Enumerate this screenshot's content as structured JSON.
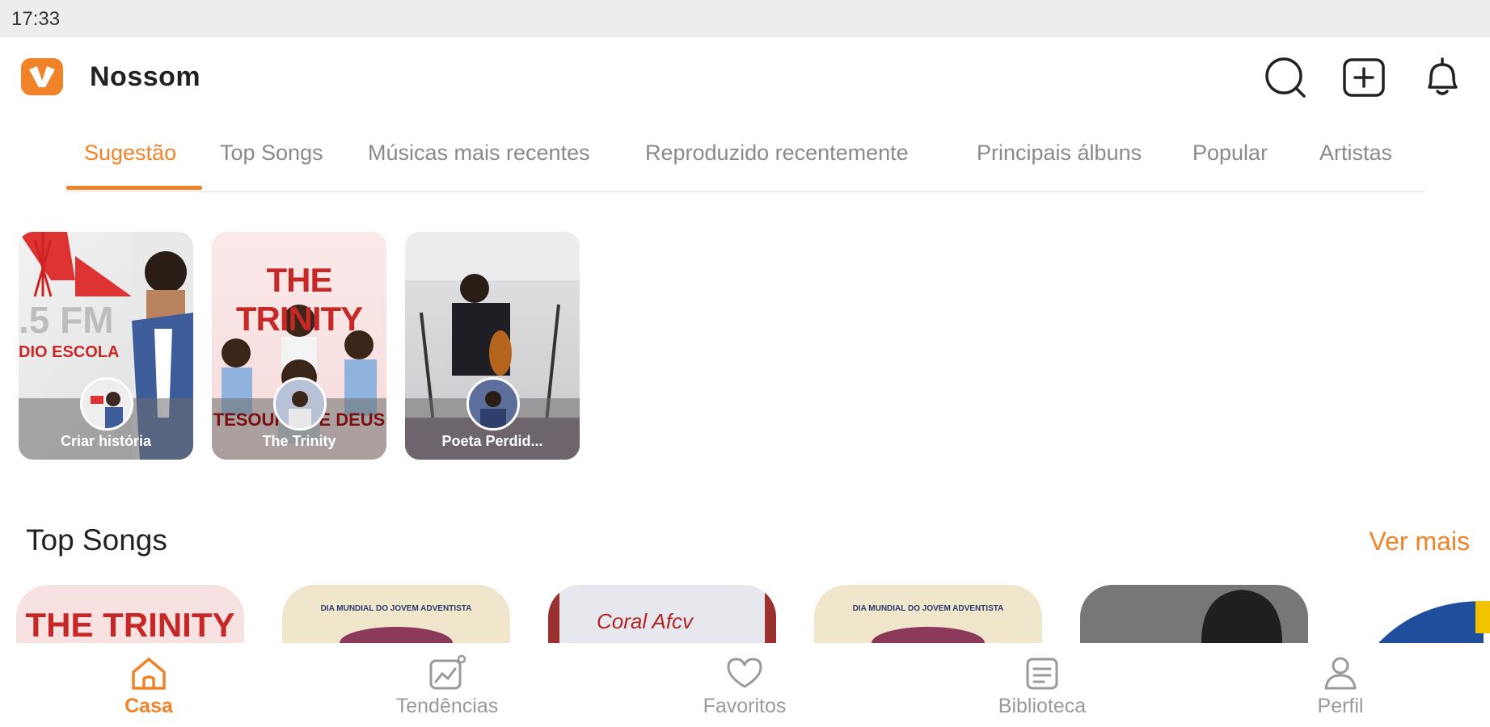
{
  "status": {
    "time": "17:33"
  },
  "app": {
    "name": "Nossom",
    "accent": "#f0832a"
  },
  "header_icons": [
    "search-icon",
    "add-post-icon",
    "bell-icon"
  ],
  "tabs": [
    {
      "label": "Sugestão",
      "active": true
    },
    {
      "label": "Top Songs"
    },
    {
      "label": "Músicas mais recentes"
    },
    {
      "label": "Reproduzido recentemente"
    },
    {
      "label": "Principais álbuns"
    },
    {
      "label": "Popular"
    },
    {
      "label": "Artistas"
    }
  ],
  "stories": [
    {
      "label": "Criar história",
      "poster_text": ".5 FM",
      "poster_sub": "DIO ESCOLA"
    },
    {
      "label": "The Trinity",
      "poster_text": "THE TRINITY",
      "poster_sub": "TESOURO DE DEUS"
    },
    {
      "label": "Poeta Perdid..."
    }
  ],
  "top_songs": {
    "title": "Top Songs",
    "see_more": "Ver mais",
    "covers": [
      {
        "text": "THE TRINITY"
      },
      {
        "text": "DIA MUNDIAL DO JOVEM ADVENTISTA"
      },
      {
        "text": "Coral Afcv"
      },
      {
        "text": "DIA MUNDIAL DO JOVEM ADVENTISTA"
      },
      {
        "text": ""
      },
      {
        "text": ""
      }
    ]
  },
  "bottom_nav": [
    {
      "label": "Casa",
      "icon": "home-icon",
      "active": true
    },
    {
      "label": "Tendências",
      "icon": "trending-icon"
    },
    {
      "label": "Favoritos",
      "icon": "heart-icon"
    },
    {
      "label": "Biblioteca",
      "icon": "library-icon"
    },
    {
      "label": "Perfil",
      "icon": "profile-icon"
    }
  ]
}
